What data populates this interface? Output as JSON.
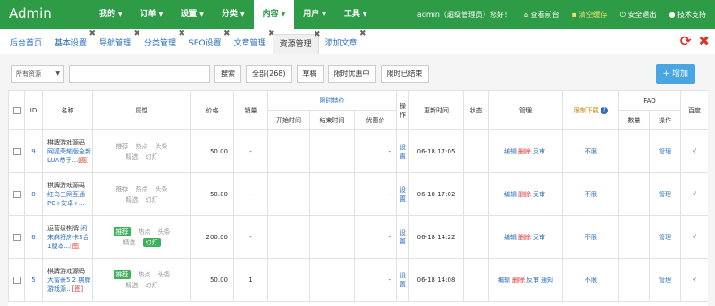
{
  "app": {
    "brand": "Admin"
  },
  "mainnav": [
    {
      "label": "我的"
    },
    {
      "label": "订单"
    },
    {
      "label": "设置"
    },
    {
      "label": "分类"
    },
    {
      "label": "内容"
    },
    {
      "label": "用户"
    },
    {
      "label": "工具"
    }
  ],
  "top": {
    "welcome": "admin（超级管理员）您好！",
    "home": "查看前台",
    "cache": "清空缓存",
    "logout": "安全退出",
    "support": "技术支持"
  },
  "tabs": [
    {
      "label": "后台首页"
    },
    {
      "label": "基本设置"
    },
    {
      "label": "导航管理"
    },
    {
      "label": "分类管理"
    },
    {
      "label": "SEO设置"
    },
    {
      "label": "文章管理"
    },
    {
      "label": "资源管理"
    },
    {
      "label": "添加文章"
    }
  ],
  "tab_tools": {
    "refresh": "⟳",
    "close": "✖"
  },
  "filters": {
    "select_value": "所有资源",
    "search_btn": "搜索",
    "all": "全部(268)",
    "draft": "草稿",
    "promo_on": "限时优惠中",
    "promo_end": "限时已结束",
    "add": "+ 增加"
  },
  "table": {
    "headers": {
      "id": "ID",
      "name": "名称",
      "attr": "属性",
      "price": "价格",
      "sales": "销量",
      "flash": "限时特价",
      "start": "开始时间",
      "end": "结束时间",
      "discount": "优惠价",
      "op": "操作",
      "updated": "更新时间",
      "status": "状态",
      "manage": "管理",
      "limit": "限制下载",
      "faq": "FAQ",
      "count": "数量",
      "faq_op": "操作",
      "baidu": "百度"
    },
    "rows": [
      {
        "id": "9",
        "category": "棋牌游戏源码",
        "title": "网狐荣耀版全新LUA带手...",
        "tag": "[图]",
        "attrs": [
          {
            "label": "推荐",
            "on": false
          },
          {
            "label": "热点",
            "on": false
          },
          {
            "label": "头条",
            "on": false
          },
          {
            "label": "精选",
            "on": false
          },
          {
            "label": "幻灯",
            "on": false
          }
        ],
        "price": "50.00",
        "sales": "-",
        "discount": "-",
        "set": "设置",
        "updated": "06-18 17:05",
        "edit": "编辑",
        "del": "删除",
        "review": "反审",
        "notify": "",
        "limit": "不限",
        "faq_manage": "管理",
        "baidu": "√"
      },
      {
        "id": "8",
        "category": "棋牌游戏源码",
        "title": "红鸟三网互通PC+安卓+...",
        "tag": "",
        "attrs": [
          {
            "label": "推荐",
            "on": false
          },
          {
            "label": "热点",
            "on": false
          },
          {
            "label": "头条",
            "on": false
          },
          {
            "label": "精选",
            "on": false
          },
          {
            "label": "幻灯",
            "on": false
          }
        ],
        "price": "50.00",
        "sales": "-",
        "discount": "-",
        "set": "设置",
        "updated": "06-18 17:02",
        "edit": "编辑",
        "del": "删除",
        "review": "反审",
        "notify": "",
        "limit": "不限",
        "faq_manage": "管理",
        "baidu": "√"
      },
      {
        "id": "6",
        "category": "运营级棋牌",
        "title": "闲来麻将房卡3合1版本...",
        "tag": "[图]",
        "attrs": [
          {
            "label": "推荐",
            "on": true
          },
          {
            "label": "热点",
            "on": false
          },
          {
            "label": "头条",
            "on": false
          },
          {
            "label": "精选",
            "on": false
          },
          {
            "label": "幻灯",
            "on": true
          }
        ],
        "price": "200.00",
        "sales": "-",
        "discount": "-",
        "set": "设置",
        "updated": "06-18 14:22",
        "edit": "编辑",
        "del": "删除",
        "review": "反审",
        "notify": "",
        "limit": "不限",
        "faq_manage": "管理",
        "baidu": "√"
      },
      {
        "id": "5",
        "category": "棋牌游戏源码",
        "title": "大富豪5.2 棋牌游戏源...",
        "tag": "[图]",
        "attrs": [
          {
            "label": "推荐",
            "on": true
          },
          {
            "label": "热点",
            "on": false
          },
          {
            "label": "头条",
            "on": false
          },
          {
            "label": "精选",
            "on": false
          },
          {
            "label": "幻灯",
            "on": false
          }
        ],
        "price": "50.00",
        "sales": "1",
        "discount": "-",
        "set": "设置",
        "updated": "06-18 14:08",
        "edit": "编辑",
        "del": "删除",
        "review": "反审",
        "notify": "通知",
        "limit": "不限",
        "faq_manage": "管理",
        "baidu": "√"
      }
    ]
  },
  "colors": {
    "brand_green": "#2e9b47",
    "link_blue": "#2a6ebd",
    "danger_red": "#d9342b",
    "add_blue": "#4aa6e2"
  }
}
